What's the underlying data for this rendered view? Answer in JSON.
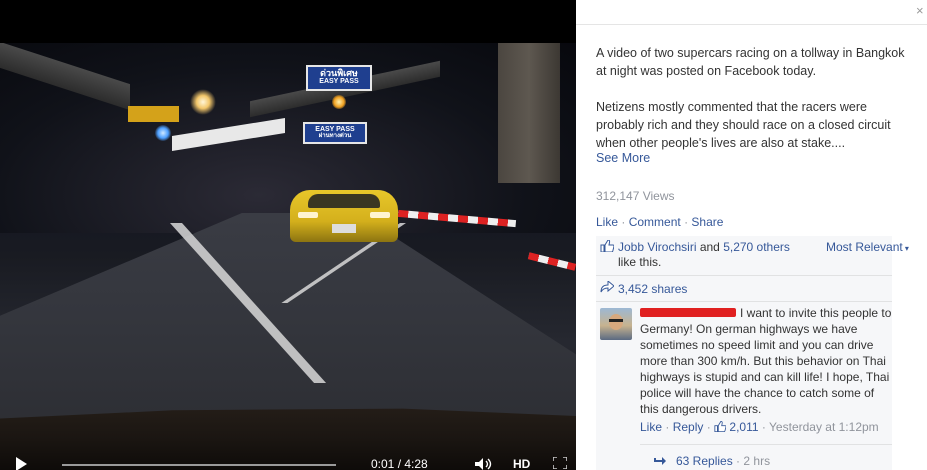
{
  "video": {
    "time_display": "0:01 / 4:28",
    "hd_label": "HD",
    "progress_fraction": 0.004,
    "signs": {
      "top_sign": "ด่วนพิเศษ",
      "top_sign_sub": "EASY PASS",
      "mid_sign": "EASY PASS",
      "mid_sign_sub": "ผ่านทางด่วน"
    }
  },
  "panel": {
    "close_glyph": "×",
    "caption_p1": "A video of two supercars racing on a tollway in Bangkok at night was posted on Facebook today.",
    "caption_p2": "Netizens mostly commented that the racers were probably rich and they should race on a closed circuit when other people's lives are also at stake....",
    "see_more": "See More",
    "views": "312,147 Views",
    "actions": {
      "like": "Like",
      "comment": "Comment",
      "share": "Share",
      "separator": "·"
    },
    "likes": {
      "name": "Jobb Virochsiri",
      "and": " and ",
      "others": "5,270 others",
      "suffix": " like this."
    },
    "sort_label": "Most Relevant",
    "shares": "3,452 shares",
    "comment": {
      "text": "I want to invite this people to Germany! On german highways we have sometimes no speed limit and you can drive more than 300 km/h. But this behavior on Thai highways is stupid and can kill life! I hope, Thai police will have the chance to catch some of this dangerous drivers.",
      "like": "Like",
      "reply": "Reply",
      "like_count": "2,011",
      "timestamp": "Yesterday at 1:12pm",
      "separator": "·"
    },
    "replies": {
      "label": "63 Replies",
      "age": "2 hrs",
      "separator": "·"
    }
  },
  "colors": {
    "link": "#365899",
    "muted": "#90949c",
    "car": "#e8c72a"
  }
}
